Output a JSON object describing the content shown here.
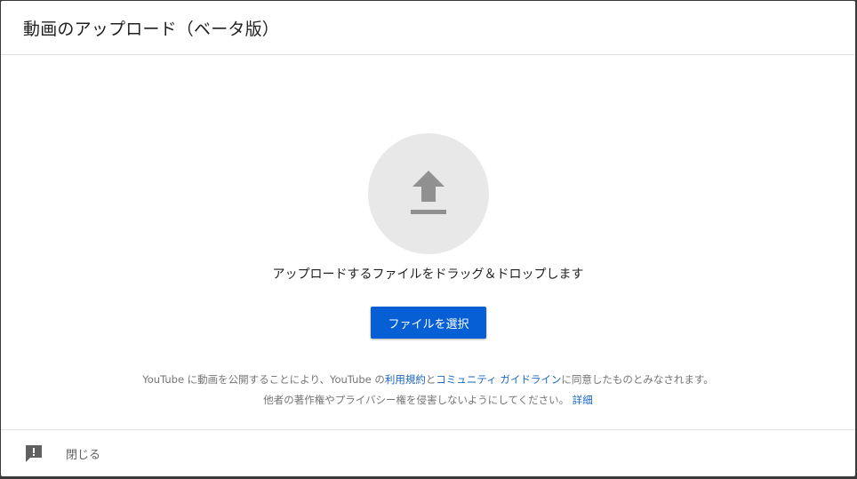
{
  "dialog": {
    "title": "動画のアップロード（ベータ版）"
  },
  "upload": {
    "icon": "upload-icon",
    "drop_text": "アップロードするファイルをドラッグ＆ドロップします",
    "select_button_label": "ファイルを選択"
  },
  "terms": {
    "line1_prefix": "YouTube に動画を公開することにより、YouTube の",
    "terms_link": "利用規約",
    "conj": "と",
    "guidelines_link": "コミュニティ ガイドライン",
    "line1_suffix": "に同意したものとみなされます。",
    "line2_text": "他者の著作権やプライバシー権を侵害しないようにしてください。",
    "learn_more_link": "詳細"
  },
  "footer": {
    "feedback_icon": "feedback-icon",
    "close_label": "閉じる"
  },
  "colors": {
    "primary_button": "#065fd4",
    "link": "#1a65c0",
    "upload_circle": "#e8e8e8",
    "icon_gray": "#909090"
  }
}
